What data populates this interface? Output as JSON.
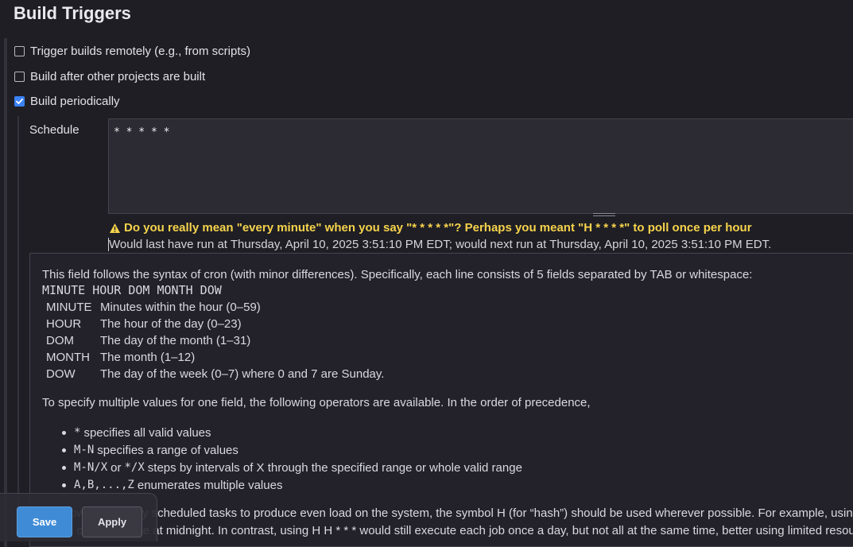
{
  "section": {
    "title": "Build Triggers"
  },
  "triggers": [
    {
      "label": "Trigger builds remotely (e.g., from scripts)",
      "checked": false
    },
    {
      "label": "Build after other projects are built",
      "checked": false
    },
    {
      "label": "Build periodically",
      "checked": true
    }
  ],
  "schedule": {
    "label": "Schedule",
    "value": "* * * * *",
    "warning": "Do you really mean \"every minute\" when you say \"* * * * *\"? Perhaps you meant \"H * * * *\" to poll once per hour",
    "info": "Would last have run at Thursday, April 10, 2025 3:51:10 PM EDT; would next run at Thursday, April 10, 2025 3:51:10 PM EDT."
  },
  "help": {
    "intro": "This field follows the syntax of cron (with minor differences). Specifically, each line consists of 5 fields separated by TAB or whitespace:",
    "syntax": "MINUTE HOUR DOM MONTH DOW",
    "fields": [
      {
        "name": "MINUTE",
        "desc": "Minutes within the hour (0–59)"
      },
      {
        "name": "HOUR",
        "desc": "The hour of the day (0–23)"
      },
      {
        "name": "DOM",
        "desc": "The day of the month (1–31)"
      },
      {
        "name": "MONTH",
        "desc": "The month (1–12)"
      },
      {
        "name": "DOW",
        "desc": "The day of the week (0–7) where 0 and 7 are Sunday."
      }
    ],
    "operators_intro": "To specify multiple values for one field, the following operators are available. In the order of precedence,",
    "operators": [
      {
        "code": "*",
        "code2": "",
        "text": "specifies all valid values",
        "mid": ""
      },
      {
        "code": "M-N",
        "code2": "",
        "text": "specifies a range of values",
        "mid": ""
      },
      {
        "code": "M-N/X",
        "mid": "or",
        "code2": "*/X",
        "text": "steps by intervals of X through the specified range or whole valid range"
      },
      {
        "code": "A,B,...,Z",
        "code2": "",
        "text": "enumerates multiple values",
        "mid": ""
      }
    ],
    "hash_line1": "To allow periodically scheduled tasks to produce even load on the system, the symbol H (for “hash”) should be used wherever possible. For example, using",
    "hash_line2": "would cause a spike at midnight. In contrast, using H H * * * would still execute each job once a day, but not all at the same time, better using limited resources."
  },
  "actions": {
    "save": "Save",
    "apply": "Apply"
  },
  "colors": {
    "warning": "#f5d34b",
    "accent": "#3f8bd6",
    "background": "#1f1e25"
  }
}
